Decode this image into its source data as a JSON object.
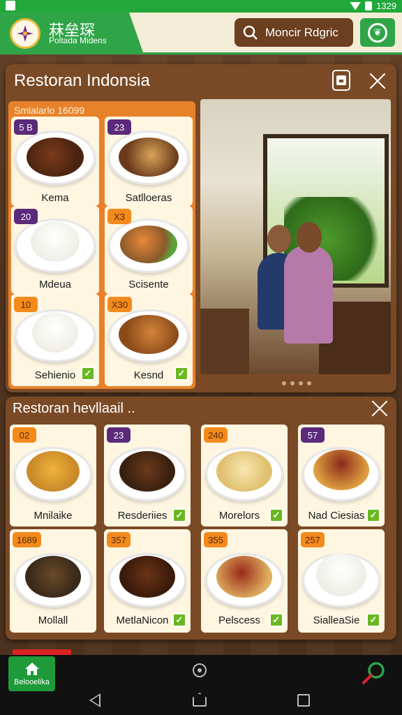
{
  "status_bar": {
    "time": "1329"
  },
  "header": {
    "brand_title": "菻垒琛",
    "brand_subtitle": "Poltada Midens",
    "search_label": "Moncir Rdgric"
  },
  "panel_featured": {
    "title": "Restoran Indonsia",
    "menu_heading": "Smlalarlo 16099",
    "items": [
      {
        "badge": "5 B",
        "name": "Kema",
        "badge_color": "purple",
        "checked": false
      },
      {
        "badge": "23",
        "name": "Satlloeras",
        "badge_color": "purple",
        "checked": false
      },
      {
        "badge": "20",
        "name": "Mdeua",
        "badge_color": "purple",
        "checked": false
      },
      {
        "badge": "X3",
        "name": "Scisente",
        "badge_color": "orange",
        "checked": false
      },
      {
        "badge": "10",
        "name": "Sehienio",
        "badge_color": "orange",
        "checked": true
      },
      {
        "badge": "X30",
        "name": "Kesnd",
        "badge_color": "orange",
        "checked": true
      }
    ]
  },
  "panel_list": {
    "title": "Restoran hevllaail ..",
    "items": [
      {
        "badge": "02",
        "name": "Mnilaike",
        "badge_color": "orange",
        "checked": false
      },
      {
        "badge": "23",
        "name": "Resderiies",
        "badge_color": "purple",
        "checked": true
      },
      {
        "badge": "240",
        "name": "Morelors",
        "badge_color": "orange",
        "checked": true
      },
      {
        "badge": "57",
        "name": "Nad Ciesias",
        "badge_color": "purple",
        "checked": true
      },
      {
        "badge": "1689",
        "name": "Mollall",
        "badge_color": "orange",
        "checked": false
      },
      {
        "badge": "357",
        "name": "MetlaNicon",
        "badge_color": "orange",
        "checked": true
      },
      {
        "badge": "355",
        "name": "Pelscess",
        "badge_color": "orange",
        "checked": true
      },
      {
        "badge": "257",
        "name": "SialleaSie",
        "badge_color": "orange",
        "checked": true
      }
    ]
  },
  "bottom_nav": {
    "home_label": "Belooelika"
  },
  "colors": {
    "brand_green": "#2fa548",
    "panel_brown": "#7a4a26",
    "menu_orange": "#e8822a",
    "badge_purple": "#5b2a7a",
    "check_green": "#6ab821"
  }
}
